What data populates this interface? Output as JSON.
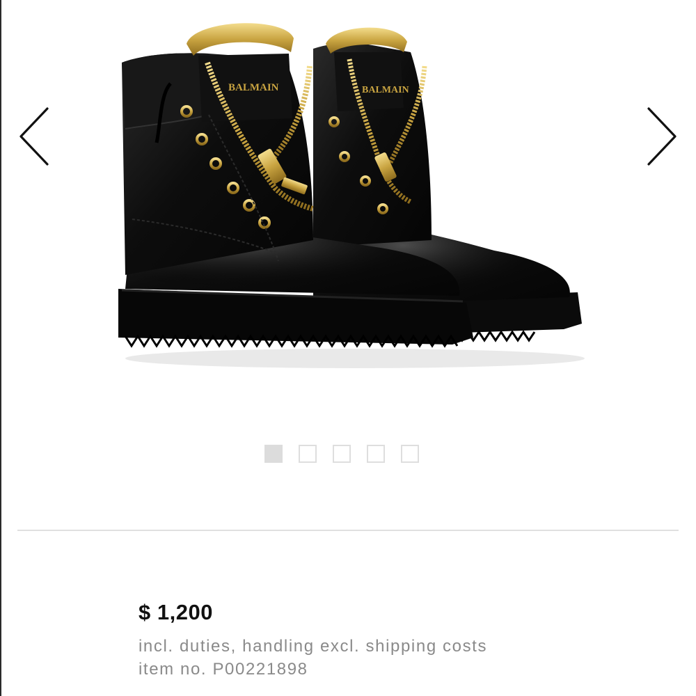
{
  "gallery": {
    "image": {
      "brand_label": "BALMAIN"
    },
    "prev_icon": "chevron-left-icon",
    "next_icon": "chevron-right-icon",
    "pagination": {
      "total": 5,
      "active_index": 0
    }
  },
  "product": {
    "price": "$ 1,200",
    "price_note": "incl. duties, handling excl. shipping costs",
    "item_number": "item no. P00221898"
  },
  "colors": {
    "accent_gold": "#c9a441",
    "dot_active": "#dcdcdc",
    "muted_text": "#8a8a8a"
  }
}
